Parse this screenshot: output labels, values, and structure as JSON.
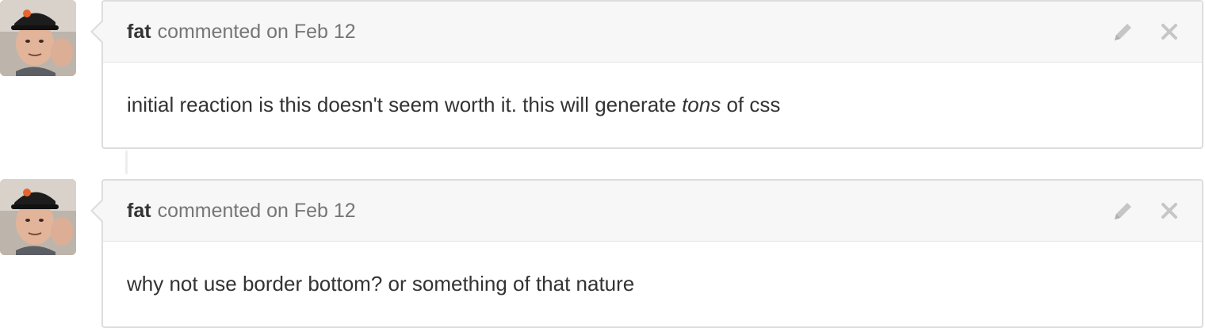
{
  "comments": [
    {
      "author": "fat",
      "action": "commented on Feb 12",
      "body_pre": "initial reaction is this doesn't seem worth it. this will generate ",
      "body_em": "tons",
      "body_post": " of css"
    },
    {
      "author": "fat",
      "action": "commented on Feb 12",
      "body": "why not use border bottom? or something of that nature"
    }
  ],
  "icons": {
    "edit": "pencil-icon",
    "delete": "close-icon"
  },
  "colors": {
    "header_bg": "#f7f7f7",
    "border": "#dddddd",
    "icon": "#c6c6c6",
    "text": "#333333",
    "meta": "#767676"
  }
}
